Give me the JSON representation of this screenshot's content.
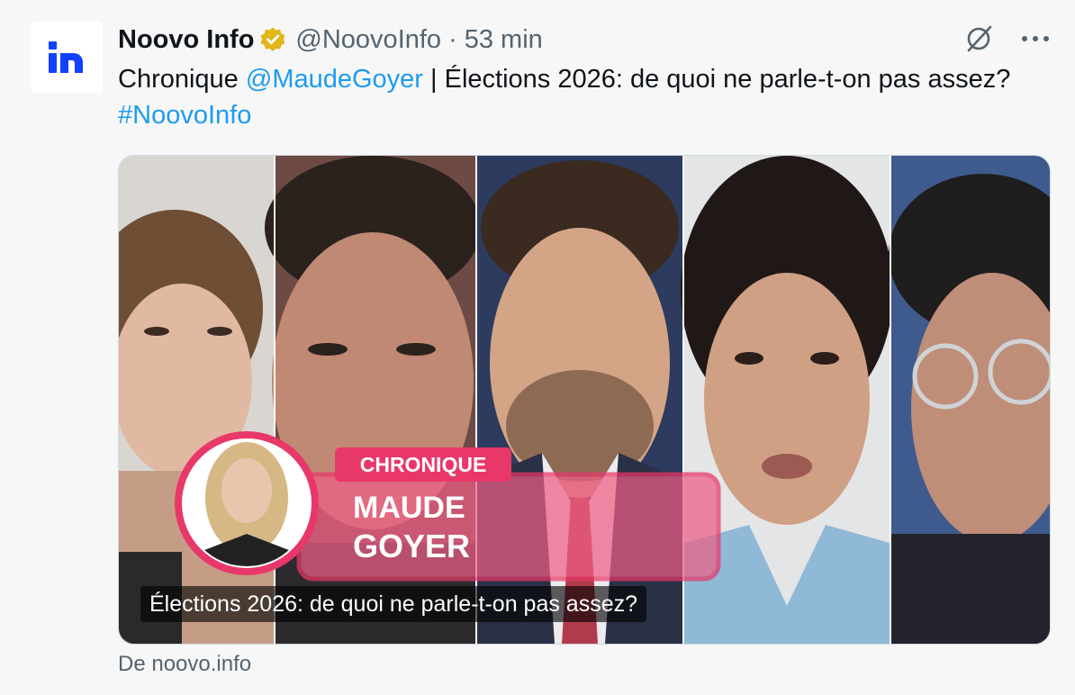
{
  "account": {
    "display_name": "Noovo Info",
    "handle": "@NoovoInfo",
    "separator": "·",
    "time": "53 min",
    "avatar_icon": "noovo-logo-icon",
    "verified_icon": "verified-badge-icon",
    "brand_color": "#1340ff"
  },
  "tweet": {
    "text_prefix": "Chronique ",
    "mention": "@MaudeGoyer",
    "text_middle": "  | Élections 2026: de quoi ne parle-t-on pas assez? ",
    "hashtag": "#NoovoInfo"
  },
  "actions": {
    "grok_icon": "grok-slash-circle-icon",
    "more_icon": "more-dots-icon"
  },
  "card": {
    "overlay_label": "CHRONIQUE",
    "overlay_first_name": "MAUDE",
    "overlay_last_name": "GOYER",
    "title": "Élections 2026: de quoi ne parle-t-on pas assez?",
    "source": "De noovo.info",
    "accent_color": "#e8386a"
  }
}
